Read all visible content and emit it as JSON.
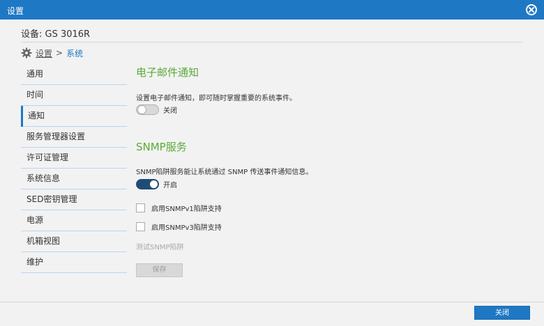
{
  "window": {
    "title": "设置"
  },
  "device": {
    "label": "设备: GS 3016R"
  },
  "breadcrumb": {
    "root": "设置",
    "separator": ">",
    "current": "系统"
  },
  "sidebar": {
    "items": [
      {
        "label": "通用"
      },
      {
        "label": "时间"
      },
      {
        "label": "通知",
        "active": true
      },
      {
        "label": "服务管理器设置"
      },
      {
        "label": "许可证管理"
      },
      {
        "label": "系统信息"
      },
      {
        "label": "SED密钥管理"
      },
      {
        "label": "电源"
      },
      {
        "label": "机箱视图"
      },
      {
        "label": "维护"
      }
    ]
  },
  "email": {
    "title": "电子邮件通知",
    "description": "设置电子邮件通知，即可随时掌握重要的系统事件。",
    "toggle_label": "关闭",
    "enabled": false
  },
  "snmp": {
    "title": "SNMP服务",
    "description": "SNMP陷阱服务能让系统通过 SNMP 传送事件通知信息。",
    "toggle_label": "开启",
    "enabled": true,
    "v1_label": "启用SNMPv1陷阱支持",
    "v3_label": "启用SNMPv3陷阱支持",
    "test_label": "测试SNMP陷阱",
    "save_label": "保存"
  },
  "footer": {
    "close_label": "关闭"
  },
  "colors": {
    "accent": "#1e78c4",
    "section_title": "#5aaa3a"
  }
}
